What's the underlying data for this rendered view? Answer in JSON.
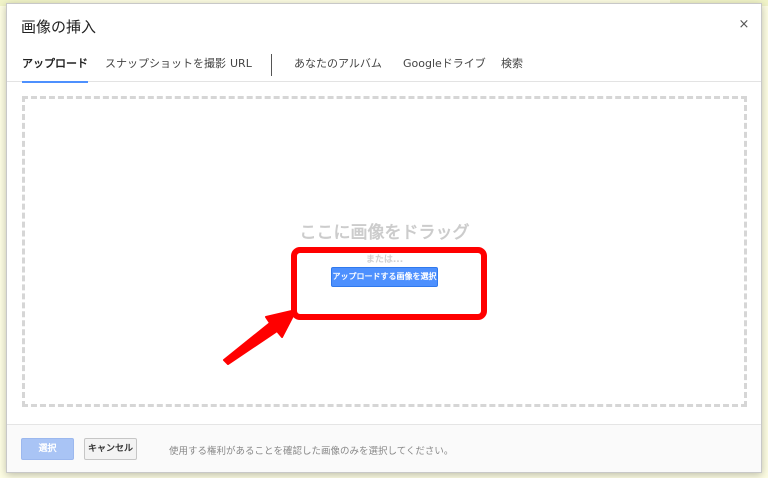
{
  "dialog": {
    "title": "画像の挿入",
    "close_icon": "close-icon",
    "close_glyph": "×"
  },
  "tabs": [
    {
      "label": "アップロード",
      "active": true
    },
    {
      "label": "スナップショットを撮影",
      "active": false
    },
    {
      "label": "URL",
      "active": false
    },
    {
      "label": "あなたのアルバム",
      "active": false
    },
    {
      "label": "Googleドライブ",
      "active": false
    },
    {
      "label": "検索",
      "active": false
    }
  ],
  "upload": {
    "drop_text": "ここに画像をドラッグ",
    "or_text": "または...",
    "choose_button": "アップロードする画像を選択"
  },
  "footer": {
    "select_button": "選択",
    "cancel_button": "キャンセル",
    "notice": "使用する権利があることを確認した画像のみを選択してください。"
  },
  "colors": {
    "accent": "#4d90fe",
    "annotation": "#ff0000"
  }
}
